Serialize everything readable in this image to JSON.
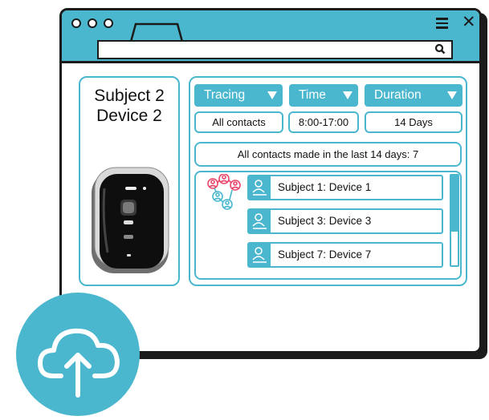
{
  "window": {
    "menu_icon": "hamburger-icon",
    "close_label": "✕",
    "search_icon": "search-icon"
  },
  "subject_panel": {
    "line1": "Subject 2",
    "line2": "Device 2"
  },
  "filters": [
    {
      "label": "Tracing",
      "value": "All contacts"
    },
    {
      "label": "Time",
      "value": "8:00-17:00"
    },
    {
      "label": "Duration",
      "value": "14 Days"
    }
  ],
  "summary": "All contacts made in the last 14 days: 7",
  "contacts": [
    {
      "label": "Subject 1: Device 1"
    },
    {
      "label": "Subject 3: Device 3"
    },
    {
      "label": "Subject 7: Device 7"
    }
  ],
  "colors": {
    "accent": "#4ab7cf",
    "outline": "#1b1b1b",
    "network_icon": "#e8486b"
  },
  "upload_icon": "cloud-upload-icon"
}
